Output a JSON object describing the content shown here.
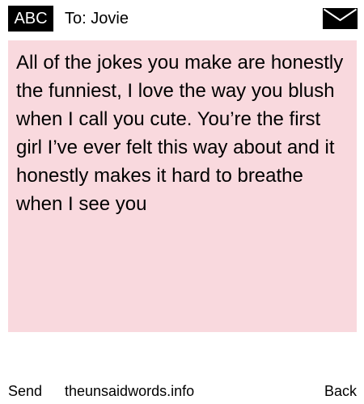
{
  "header": {
    "input_mode": "ABC",
    "recipient_label": "To:",
    "recipient_name": "Jovie",
    "envelope_icon": "envelope-icon"
  },
  "message": {
    "body": "All of the jokes you make are honestly the funniest, I love the way you blush when I call you cute. You’re the first girl I’ve ever felt this way about and it honestly makes it hard to breathe when I see you"
  },
  "softkeys": {
    "left": "Send",
    "center": "theunsaidwords.info",
    "right": "Back"
  },
  "colors": {
    "message_background": "#f9d9de",
    "badge_background": "#000000",
    "badge_text": "#ffffff"
  }
}
